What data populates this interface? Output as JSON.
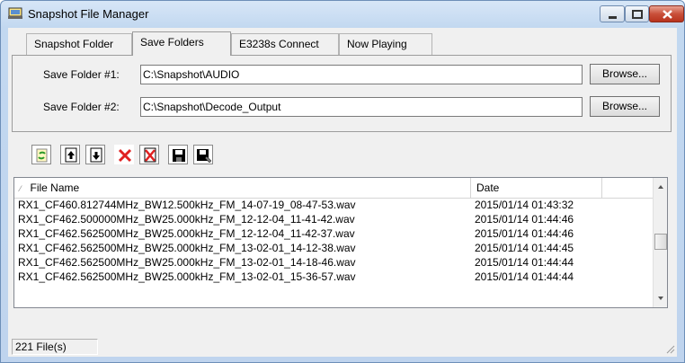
{
  "window": {
    "title": "Snapshot File Manager"
  },
  "tabs": [
    {
      "label": "Snapshot Folder",
      "active": false
    },
    {
      "label": "Save Folders",
      "active": true
    },
    {
      "label": "E3238s Connect",
      "active": false
    },
    {
      "label": "Now Playing",
      "active": false
    }
  ],
  "save_folders": [
    {
      "label": "Save Folder #1:",
      "value": "C:\\Snapshot\\AUDIO",
      "button": "Browse..."
    },
    {
      "label": "Save Folder #2:",
      "value": "C:\\Snapshot\\Decode_Output",
      "button": "Browse..."
    }
  ],
  "toolbar": {
    "icons": [
      "refresh-icon",
      "move-up-icon",
      "move-down-icon",
      "delete-icon",
      "delete-file-icon",
      "save-icon",
      "save-as-icon"
    ]
  },
  "file_list": {
    "columns": [
      "File Name",
      "Date"
    ],
    "rows": [
      {
        "name": "RX1_CF460.812744MHz_BW12.500kHz_FM_14-07-19_08-47-53.wav",
        "date": "2015/01/14 01:43:32"
      },
      {
        "name": "RX1_CF462.500000MHz_BW25.000kHz_FM_12-12-04_11-41-42.wav",
        "date": "2015/01/14 01:44:46"
      },
      {
        "name": "RX1_CF462.562500MHz_BW25.000kHz_FM_12-12-04_11-42-37.wav",
        "date": "2015/01/14 01:44:46"
      },
      {
        "name": "RX1_CF462.562500MHz_BW25.000kHz_FM_13-02-01_14-12-38.wav",
        "date": "2015/01/14 01:44:45"
      },
      {
        "name": "RX1_CF462.562500MHz_BW25.000kHz_FM_13-02-01_14-18-46.wav",
        "date": "2015/01/14 01:44:44"
      },
      {
        "name": "RX1_CF462.562500MHz_BW25.000kHz_FM_13-02-01_15-36-57.wav",
        "date": "2015/01/14 01:44:44"
      }
    ]
  },
  "status": {
    "file_count": "221 File(s)"
  },
  "colors": {
    "title_bar": "#c8dbf0",
    "close_button": "#c9503a",
    "accent_red": "#e02020",
    "accent_green": "#2a9a2a"
  }
}
